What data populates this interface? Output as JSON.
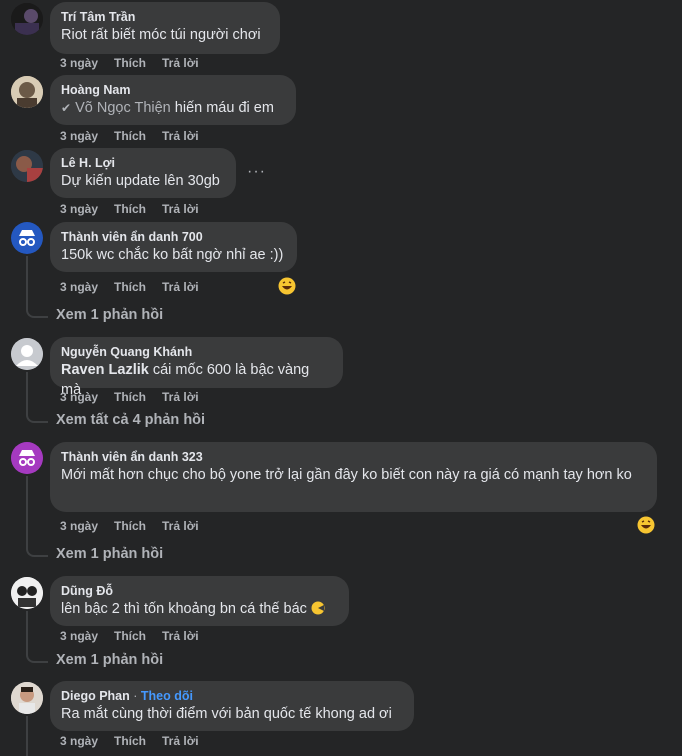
{
  "actions": {
    "time": "3 ngày",
    "like": "Thích",
    "reply": "Trả lời"
  },
  "comments": [
    {
      "name": "Trí Tâm Trần",
      "text": "Riot rất biết móc túi người chơi"
    },
    {
      "name": "Hoàng Nam",
      "mention": "Võ Ngọc Thiện",
      "text": " hiến máu đi em"
    },
    {
      "name": "Lê H. Lợi",
      "text": "Dự kiến update lên 30gb",
      "more": "···"
    },
    {
      "name": "Thành viên ẩn danh 700",
      "text": "150k wc chắc ko bất ngờ nhỉ ae :))",
      "replies": "Xem 1 phản hồi"
    },
    {
      "name": "Nguyễn Quang Khánh",
      "bold": "Raven Lazlik",
      "text": " cái mốc 600 là bậc vàng mà",
      "replies": "Xem tất cả 4 phản hồi"
    },
    {
      "name": "Thành viên ẩn danh 323",
      "text": "Mới mất hơn chục cho bộ yone trở lại gần đây ko biết con này ra giá có mạnh tay hơn ko",
      "replies": "Xem 1 phản hồi"
    },
    {
      "name": "Dũng Đỗ",
      "text": "lên bậc 2 thì tốn khoảng bn cá thế bác",
      "replies": "Xem 1 phản hồi"
    },
    {
      "name": "Diego Phan",
      "follow_sep": " · ",
      "follow": "Theo dõi",
      "text": "Ra mắt cùng thời điểm với bản quốc tế khong ad ơi"
    }
  ]
}
